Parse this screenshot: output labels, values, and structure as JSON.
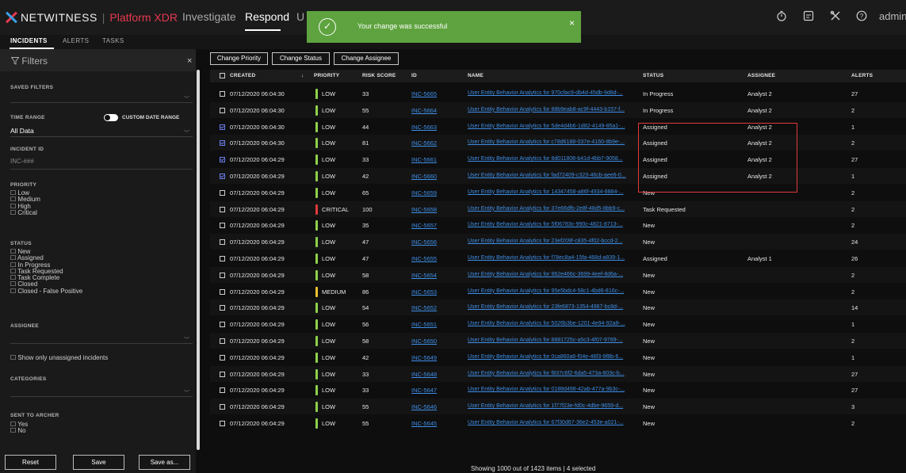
{
  "app": {
    "brand": "NETWITNESS",
    "platform": "Platform XDR",
    "nav": [
      "Investigate",
      "Respond"
    ],
    "nav_partial": "U",
    "user": "admin >"
  },
  "subnav": [
    "INCIDENTS",
    "ALERTS",
    "TASKS"
  ],
  "toast": {
    "message": "Your change was successful",
    "close": "×",
    "check": "✓"
  },
  "sidebar": {
    "title": "Filters",
    "close": "×",
    "saved_filters_label": "SAVED FILTERS",
    "time_range_label": "TIME RANGE",
    "custom_date_range_label": "CUSTOM DATE RANGE",
    "time_range_value": "All Data",
    "incident_id_label": "INCIDENT ID",
    "incident_id_placeholder": "INC-###",
    "priority_label": "PRIORITY",
    "priority_options": [
      "Low",
      "Medium",
      "High",
      "Critical"
    ],
    "status_label": "STATUS",
    "status_options": [
      "New",
      "Assigned",
      "In Progress",
      "Task Requested",
      "Task Complete",
      "Closed",
      "Closed - False Positive"
    ],
    "assignee_label": "ASSIGNEE",
    "unassigned_label": "Show only unassigned incidents",
    "categories_label": "CATEGORIES",
    "sent_to_archer_label": "SENT TO ARCHER",
    "archer_options": [
      "Yes",
      "No"
    ],
    "reset": "Reset",
    "save": "Save",
    "save_as": "Save as..."
  },
  "toolbar": {
    "change_priority": "Change Priority",
    "change_status": "Change Status",
    "change_assignee": "Change Assignee"
  },
  "table": {
    "columns": [
      "CREATED",
      "PRIORITY",
      "RISK SCORE",
      "ID",
      "NAME",
      "STATUS",
      "ASSIGNEE",
      "ALERTS"
    ],
    "sort_arrow": "↓",
    "rows": [
      {
        "checked": false,
        "created": "07/12/2020 06:04:30",
        "priority": "LOW",
        "risk": "33",
        "id": "INC-5665",
        "name": "User Entity Behavior Analytics for 970cfac9-db4d-45db-9d8d-...",
        "status": "In Progress",
        "assignee": "Analyst 2",
        "alerts": "27"
      },
      {
        "checked": false,
        "created": "07/12/2020 06:04:30",
        "priority": "LOW",
        "risk": "55",
        "id": "INC-5664",
        "name": "User Entity Behavior Analytics for 88b9eab8-ac9f-4443-b157-f...",
        "status": "In Progress",
        "assignee": "Analyst 2",
        "alerts": "2"
      },
      {
        "checked": true,
        "created": "07/12/2020 06:04:30",
        "priority": "LOW",
        "risk": "44",
        "id": "INC-5663",
        "name": "User Entity Behavior Analytics for 5de4d4b6-1d82-4149-85a1-...",
        "status": "Assigned",
        "assignee": "Analyst 2",
        "alerts": "1"
      },
      {
        "checked": true,
        "created": "07/12/2020 06:04:30",
        "priority": "LOW",
        "risk": "81",
        "id": "INC-5662",
        "name": "User Entity Behavior Analytics for c78d6188-037e-4160-8b9e-...",
        "status": "Assigned",
        "assignee": "Analyst 2",
        "alerts": "2"
      },
      {
        "checked": true,
        "created": "07/12/2020 06:04:29",
        "priority": "LOW",
        "risk": "33",
        "id": "INC-5661",
        "name": "User Entity Behavior Analytics for 8d011808-b41d-4bb7-9058...",
        "status": "Assigned",
        "assignee": "Analyst 2",
        "alerts": "27"
      },
      {
        "checked": true,
        "created": "07/12/2020 06:04:29",
        "priority": "LOW",
        "risk": "42",
        "id": "INC-5660",
        "name": "User Entity Behavior Analytics for fad72409-c323-46cb-aee6-0...",
        "status": "Assigned",
        "assignee": "Analyst 2",
        "alerts": "1"
      },
      {
        "checked": false,
        "created": "07/12/2020 06:04:29",
        "priority": "LOW",
        "risk": "65",
        "id": "INC-5659",
        "name": "User Entity Behavior Analytics for 14347458-a86f-4934-8884-...",
        "status": "New",
        "assignee": "",
        "alerts": "2"
      },
      {
        "checked": false,
        "created": "07/12/2020 06:04:29",
        "priority": "CRITICAL",
        "risk": "100",
        "id": "INC-5658",
        "name": "User Entity Behavior Analytics for 37e66dfb-2e8f-48d5-8bb9-c...",
        "status": "Task Requested",
        "assignee": "",
        "alerts": "2"
      },
      {
        "checked": false,
        "created": "07/12/2020 06:04:29",
        "priority": "LOW",
        "risk": "35",
        "id": "INC-5657",
        "name": "User Entity Behavior Analytics for 5f06783c-990c-4821-8713-...",
        "status": "New",
        "assignee": "",
        "alerts": "2"
      },
      {
        "checked": false,
        "created": "07/12/2020 06:04:29",
        "priority": "LOW",
        "risk": "47",
        "id": "INC-5656",
        "name": "User Entity Behavior Analytics for 23ef209f-c835-4f02-bccd-2...",
        "status": "New",
        "assignee": "",
        "alerts": "24"
      },
      {
        "checked": false,
        "created": "07/12/2020 06:04:29",
        "priority": "LOW",
        "risk": "47",
        "id": "INC-5655",
        "name": "User Entity Behavior Analytics for f78ec8a4-15fa-468d-a839-1...",
        "status": "Assigned",
        "assignee": "Analyst 1",
        "alerts": "26"
      },
      {
        "checked": false,
        "created": "07/12/2020 06:04:29",
        "priority": "LOW",
        "risk": "58",
        "id": "INC-5654",
        "name": "User Entity Behavior Analytics for 962e466c-3699-4eef-8d6a-...",
        "status": "New",
        "assignee": "",
        "alerts": "2"
      },
      {
        "checked": false,
        "created": "07/12/2020 06:04:29",
        "priority": "MEDIUM",
        "risk": "86",
        "id": "INC-5653",
        "name": "User Entity Behavior Analytics for 95e5bdc4-58c1-4bd6-816c-...",
        "status": "New",
        "assignee": "",
        "alerts": "2"
      },
      {
        "checked": false,
        "created": "07/12/2020 06:04:29",
        "priority": "LOW",
        "risk": "54",
        "id": "INC-5652",
        "name": "User Entity Behavior Analytics for 23fe6873-1354-4967-bc8d-...",
        "status": "New",
        "assignee": "",
        "alerts": "14"
      },
      {
        "checked": false,
        "created": "07/12/2020 06:04:29",
        "priority": "LOW",
        "risk": "56",
        "id": "INC-5651",
        "name": "User Entity Behavior Analytics for 5026b3be-1201-4e94-92a8-...",
        "status": "New",
        "assignee": "",
        "alerts": "1"
      },
      {
        "checked": false,
        "created": "07/12/2020 06:04:29",
        "priority": "LOW",
        "risk": "58",
        "id": "INC-5650",
        "name": "User Entity Behavior Analytics for 8881725c-a5c3-4f07-9789-...",
        "status": "New",
        "assignee": "",
        "alerts": "2"
      },
      {
        "checked": false,
        "created": "07/12/2020 06:04:29",
        "priority": "LOW",
        "risk": "42",
        "id": "INC-5649",
        "name": "User Entity Behavior Analytics for 0ca860a6-f04e-46f3-9f8b-6...",
        "status": "New",
        "assignee": "",
        "alerts": "1"
      },
      {
        "checked": false,
        "created": "07/12/2020 06:04:29",
        "priority": "LOW",
        "risk": "33",
        "id": "INC-5648",
        "name": "User Entity Behavior Analytics for f837c6f2-6da5-473a-803c-b...",
        "status": "New",
        "assignee": "",
        "alerts": "27"
      },
      {
        "checked": false,
        "created": "07/12/2020 06:04:29",
        "priority": "LOW",
        "risk": "33",
        "id": "INC-5647",
        "name": "User Entity Behavior Analytics for 0188d498-42ab-477a-9b3c-...",
        "status": "New",
        "assignee": "",
        "alerts": "27"
      },
      {
        "checked": false,
        "created": "07/12/2020 06:04:29",
        "priority": "LOW",
        "risk": "55",
        "id": "INC-5646",
        "name": "User Entity Behavior Analytics for 1f77f23e-fd0c-4dbe-9659-d...",
        "status": "New",
        "assignee": "",
        "alerts": "3"
      },
      {
        "checked": false,
        "created": "07/12/2020 06:04:29",
        "priority": "LOW",
        "risk": "55",
        "id": "INC-5645",
        "name": "User Entity Behavior Analytics for 67f30d67-36e2-453e-a021-...",
        "status": "New",
        "assignee": "",
        "alerts": "2"
      }
    ]
  },
  "footer": {
    "text": "Showing 1000 out of 1423 items | 4 selected"
  },
  "colors": {
    "low": "#8fd14a",
    "medium": "#f2c12e",
    "critical": "#e23a3a",
    "link": "#3f8ee6",
    "toast": "#5ea33f",
    "highlight": "#e23a3a"
  },
  "icons": [
    "timer-icon",
    "report-icon",
    "tools-icon",
    "help-icon",
    "filter-icon",
    "check-circle-icon"
  ]
}
